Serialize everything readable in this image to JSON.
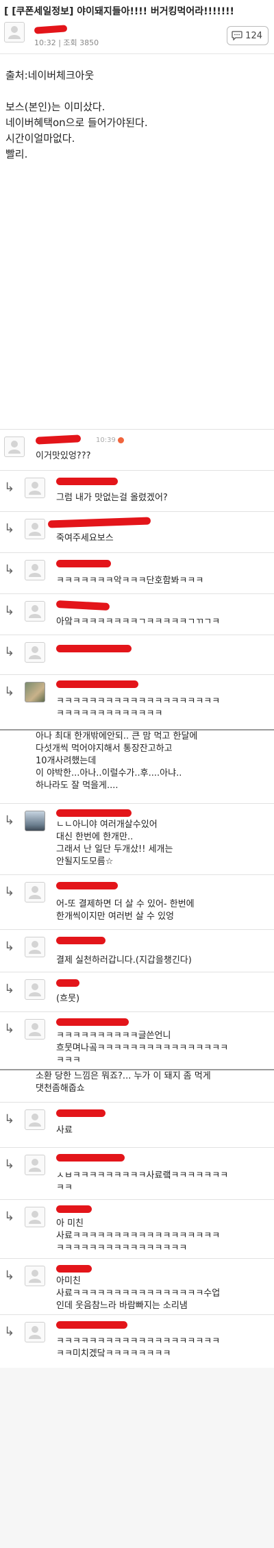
{
  "post": {
    "title": "[ [쿠폰세일정보] 야이돼지들아!!!! 버거킹먹어라!!!!!!!",
    "time": "10:32",
    "views_label": "조회 3850",
    "comment_count": "124",
    "body_lines": [
      "출처:네이버체크아웃",
      "보스(본인)는 이미샀다.",
      "네이버혜택on으로 들어가야된다.",
      "시간이얼마없다.",
      "빨리."
    ]
  },
  "comments": [
    {
      "type": "top",
      "time": "10:39",
      "lines": [
        "이거맛있엉???"
      ]
    },
    {
      "type": "reply",
      "lines": [
        "그럼 내가 맛없는걸 올렸겠어?"
      ]
    },
    {
      "type": "reply",
      "lines": [
        "죽여주세요보스"
      ]
    },
    {
      "type": "reply",
      "lines": [
        "ㅋㅋㅋㅋㅋㅋㅋ악ㅋㅋㅋ단호함봐ㅋㅋㅋ"
      ]
    },
    {
      "type": "reply",
      "lines": [
        "아앜ㅋㅋㅋㅋㅋㅋㅋㅋㄱㅋㅋㅋㅋㅋㄱㄲㄱㅋ"
      ]
    },
    {
      "type": "reply",
      "lines": []
    },
    {
      "type": "reply",
      "lines": [
        "ㅋㅋㅋㅋㅋㅋㅋㅋㅋㅋㅋㅋㅋㅋㅋㅋㅋㅋㅋㅋ",
        "ㅋㅋㅋㅋㅋㅋㅋㅋㅋㅋㅋㅋㅋ"
      ]
    },
    {
      "type": "top",
      "lines": [
        "아나 최대 한개밖에안되.. 큰 맘 먹고 한달에",
        "다섯개씩 먹어야지해서 통장잔고하고",
        "10개사려했는데",
        "이 야박한...아나..이럴수가..후....아냐..",
        "하나라도 잘 먹을게...."
      ]
    },
    {
      "type": "reply",
      "lines": [
        "ㄴㄴ아니야 여러개살수있어",
        "대신 한번에 한개만..",
        "그래서 난 일단 두개샀!! 세개는",
        "안될지도모름☆"
      ]
    },
    {
      "type": "reply",
      "lines": [
        "어-또 결제하면 더 살 수 있어- 한번에",
        "한개씩이지만 여러번 살 수 있엉"
      ]
    },
    {
      "type": "reply",
      "lines": [
        "결제 실천하러갑니다.(지갑을챙긴다)"
      ]
    },
    {
      "type": "reply",
      "lines": [
        "(흐뭇)"
      ]
    },
    {
      "type": "reply",
      "lines": [
        "ㅋㅋㅋㅋㅋㅋㅋㅋㅋㅋ글쓴언니",
        "흐뭇며나곸ㅋㅋㅋㅋㅋㅋㅋㅋㅋㅋㅋㅋㅋㅋㅋㅋ",
        "ㅋㅋㅋ"
      ]
    },
    {
      "type": "top",
      "lines": [
        "소환 당한 느낌은 뭐죠?... 누가 이 돼지 좀 먹게",
        "댓천좀해줍쇼"
      ]
    },
    {
      "type": "reply",
      "lines": [
        "사료"
      ]
    },
    {
      "type": "reply",
      "lines": [
        "ㅅㅂㅋㅋㅋㅋㅋㅋㅋㅋㅋ사료랰ㅋㅋㅋㅋㅋㅋㅋ",
        "ㅋㅋ"
      ]
    },
    {
      "type": "reply",
      "lines": [
        "아 미친",
        "사료ㅋㅋㅋㅋㅋㅋㅋㅋㅋㅋㅋㅋㅋㅋㅋㅋㅋㅋ",
        "ㅋㅋㅋㅋㅋㅋㅋㅋㅋㅋㅋㅋㅋㅋㅋㅋ"
      ]
    },
    {
      "type": "reply",
      "lines": [
        "아미친",
        "사료ㅋㅋㅋㅋㅋㅋㅋㅋㅋㅋㅋㅋㅋㅋㅋㅋ수업",
        "인데 웃음참느라 바람빠지는 소리냄"
      ]
    },
    {
      "type": "reply",
      "lines": [
        "ㅋㅋㅋㅋㅋㅋㅋㅋㅋㅋㅋㅋㅋㅋㅋㅋㅋㅋㅋㅋ",
        "ㅋㅋ미치겠닼ㅋㅋㅋㅋㅋㅋㅋㅋ"
      ]
    }
  ]
}
